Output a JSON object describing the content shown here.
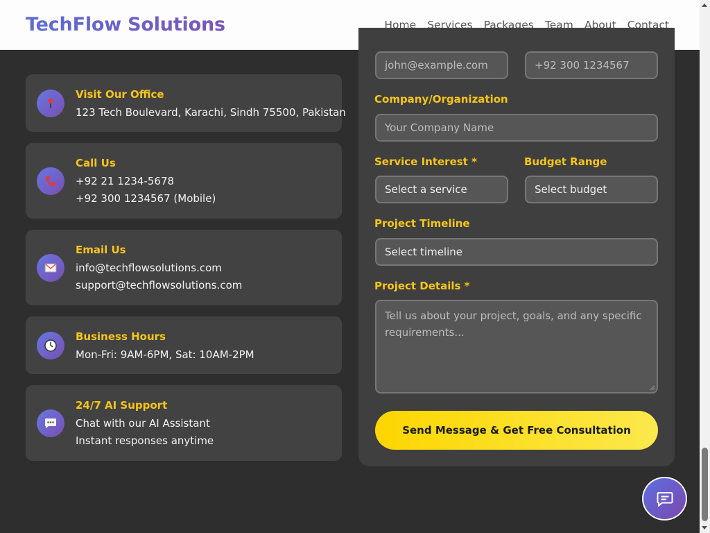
{
  "header": {
    "brand": "TechFlow Solutions",
    "nav": [
      "Home",
      "Services",
      "Packages",
      "Team",
      "About",
      "Contact"
    ]
  },
  "contact_cards": [
    {
      "title": "Visit Our Office",
      "lines": [
        "123 Tech Boulevard, Karachi, Sindh 75500, Pakistan"
      ],
      "icon": "map-pin-icon"
    },
    {
      "title": "Call Us",
      "lines": [
        "+92 21 1234-5678",
        "+92 300 1234567 (Mobile)"
      ],
      "icon": "phone-icon"
    },
    {
      "title": "Email Us",
      "lines": [
        "info@techflowsolutions.com",
        "support@techflowsolutions.com"
      ],
      "icon": "mail-icon"
    },
    {
      "title": "Business Hours",
      "lines": [
        "Mon-Fri: 9AM-6PM, Sat: 10AM-2PM"
      ],
      "icon": "clock-icon"
    },
    {
      "title": "24/7 AI Support",
      "lines": [
        "Chat with our AI Assistant",
        "Instant responses anytime"
      ],
      "icon": "chat-bubble-icon"
    }
  ],
  "form": {
    "email_placeholder": "john@example.com",
    "phone_placeholder": "+92 300 1234567",
    "company_label": "Company/Organization",
    "company_placeholder": "Your Company Name",
    "service_label": "Service Interest *",
    "service_value": "Select a service",
    "budget_label": "Budget Range",
    "budget_value": "Select budget",
    "timeline_label": "Project Timeline",
    "timeline_value": "Select timeline",
    "details_label": "Project Details *",
    "details_placeholder": "Tell us about your project, goals, and any specific requirements...",
    "submit_label": "Send Message & Get Free Consultation"
  },
  "colors": {
    "accent_gold": "#f7c51a",
    "brand_purple": "#6b5fc8",
    "background": "#2e2e2e"
  },
  "chat_fab": {
    "icon": "chat-icon"
  }
}
